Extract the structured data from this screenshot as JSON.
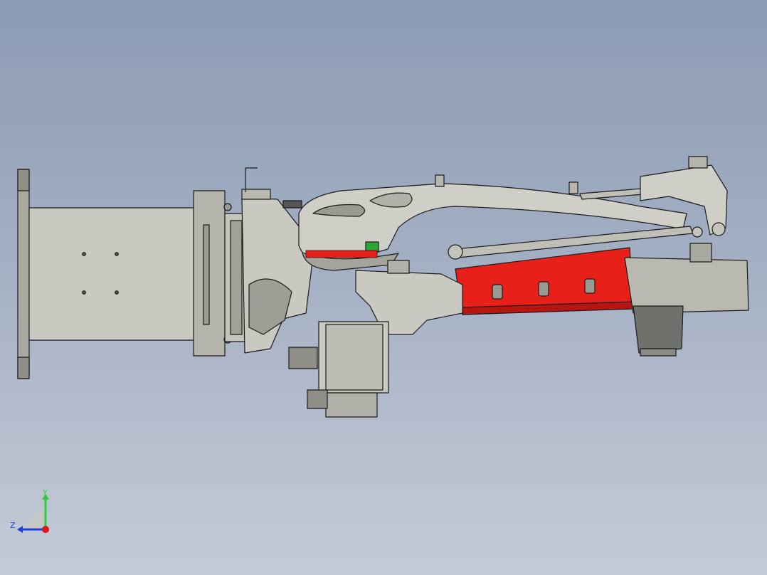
{
  "viewport": {
    "background_top": "#8b9bb4",
    "background_bottom": "#c4cbd7"
  },
  "model": {
    "colors": {
      "body_grey": "#c9c9c1",
      "body_shade": "#8f8f88",
      "edge": "#1a1a1a",
      "arm_red": "#e8201a",
      "arm_red_shade": "#b81510",
      "motor_dark": "#6f726c",
      "pad_grey": "#bfbfb8"
    }
  },
  "triad": {
    "y_label": "Y",
    "z_label": "Z",
    "y_color": "#2ecc40",
    "z_color": "#1f3fd8",
    "x_color": "#e0151a"
  }
}
